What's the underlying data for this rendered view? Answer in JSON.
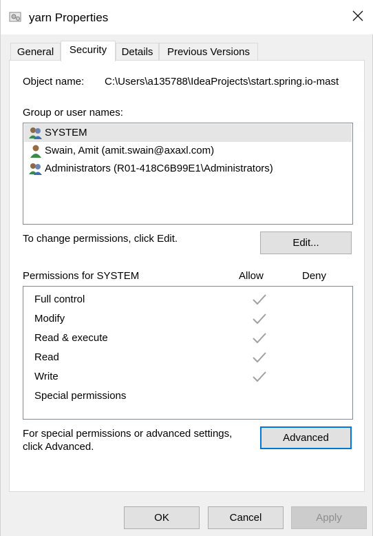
{
  "window": {
    "title": "yarn Properties",
    "icon": "folder-properties-icon"
  },
  "tabs": [
    {
      "label": "General",
      "active": false
    },
    {
      "label": "Security",
      "active": true
    },
    {
      "label": "Details",
      "active": false
    },
    {
      "label": "Previous Versions",
      "active": false
    }
  ],
  "security": {
    "object_name_label": "Object name:",
    "object_name_value": "C:\\Users\\a135788\\IdeaProjects\\start.spring.io-mast",
    "group_label": "Group or user names:",
    "users": [
      {
        "name": "SYSTEM",
        "icon": "group-users-icon",
        "selected": true
      },
      {
        "name": "Swain, Amit (amit.swain@axaxl.com)",
        "icon": "user-icon",
        "selected": false
      },
      {
        "name": "Administrators (R01-418C6B99E1\\Administrators)",
        "icon": "group-users-icon",
        "selected": false
      }
    ],
    "change_hint": "To change permissions, click Edit.",
    "edit_button": "Edit...",
    "permissions_for": "Permissions for SYSTEM",
    "allow_header": "Allow",
    "deny_header": "Deny",
    "permissions": [
      {
        "name": "Full control",
        "allow": true,
        "deny": false
      },
      {
        "name": "Modify",
        "allow": true,
        "deny": false
      },
      {
        "name": "Read & execute",
        "allow": true,
        "deny": false
      },
      {
        "name": "Read",
        "allow": true,
        "deny": false
      },
      {
        "name": "Write",
        "allow": true,
        "deny": false
      },
      {
        "name": "Special permissions",
        "allow": false,
        "deny": false
      }
    ],
    "advanced_hint_line1": "For special permissions or advanced settings,",
    "advanced_hint_line2": "click Advanced.",
    "advanced_button": "Advanced"
  },
  "footer": {
    "ok": "OK",
    "cancel": "Cancel",
    "apply": "Apply"
  },
  "colors": {
    "accent": "#0078d7",
    "check_disabled": "#a0a0a0"
  }
}
